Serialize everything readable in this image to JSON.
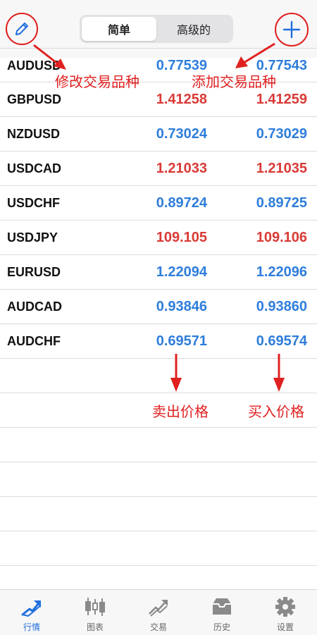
{
  "header": {
    "segments": [
      "简单",
      "高级的"
    ]
  },
  "quotes": [
    {
      "symbol": "AUDUSD",
      "bid": "0.77539",
      "ask": "0.77543",
      "color": "#2e7ddb"
    },
    {
      "symbol": "GBPUSD",
      "bid": "1.41258",
      "ask": "1.41259",
      "color": "#d93a36"
    },
    {
      "symbol": "NZDUSD",
      "bid": "0.73024",
      "ask": "0.73029",
      "color": "#2e7ddb"
    },
    {
      "symbol": "USDCAD",
      "bid": "1.21033",
      "ask": "1.21035",
      "color": "#d93a36"
    },
    {
      "symbol": "USDCHF",
      "bid": "0.89724",
      "ask": "0.89725",
      "color": "#2e7ddb"
    },
    {
      "symbol": "USDJPY",
      "bid": "109.105",
      "ask": "109.106",
      "color": "#d93a36"
    },
    {
      "symbol": "EURUSD",
      "bid": "1.22094",
      "ask": "1.22096",
      "color": "#2e7ddb"
    },
    {
      "symbol": "AUDCAD",
      "bid": "0.93846",
      "ask": "0.93860",
      "color": "#2e7ddb"
    },
    {
      "symbol": "AUDCHF",
      "bid": "0.69571",
      "ask": "0.69574",
      "color": "#2e7ddb"
    }
  ],
  "annotations": {
    "edit": "修改交易品种",
    "add": "添加交易品种",
    "sell": "卖出价格",
    "buy": "买入价格"
  },
  "tabs": [
    {
      "label": "行情",
      "icon": "quotes-icon"
    },
    {
      "label": "图表",
      "icon": "chart-icon"
    },
    {
      "label": "交易",
      "icon": "trade-icon"
    },
    {
      "label": "历史",
      "icon": "history-icon"
    },
    {
      "label": "设置",
      "icon": "gear-icon"
    }
  ],
  "colors": {
    "accent": "#1f6fe0",
    "annotation": "#e02020",
    "bid_up": "#2e7ddb",
    "bid_down": "#d93a36"
  }
}
